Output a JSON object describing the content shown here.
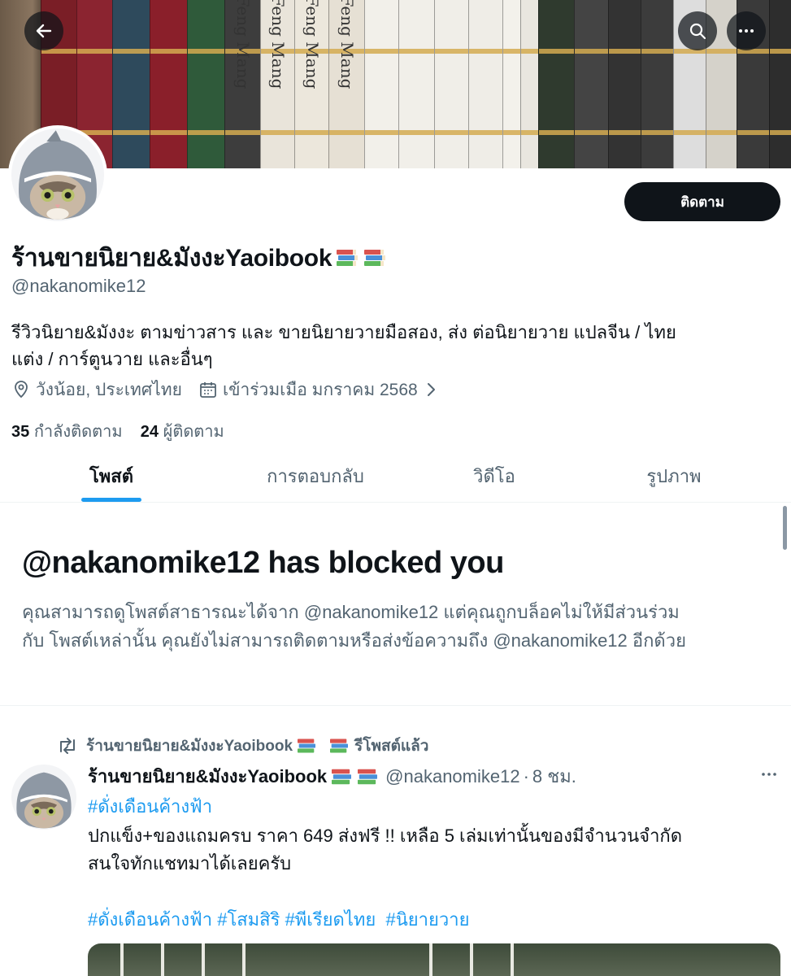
{
  "banner": {
    "books": [
      "",
      "",
      "",
      "",
      "",
      "Feng Mang",
      "Feng Mang",
      "Feng Mang",
      "Feng Mang",
      "",
      "",
      "",
      "",
      "",
      "",
      "",
      ""
    ]
  },
  "profile": {
    "follow_label": "ติดตาม",
    "display_name": "ร้านขายนิยาย&มังงะYaoibook",
    "handle": "@nakanomike12",
    "bio_line1": "รีวิวนิยาย&มังงะ ตามข่าวสาร และ ขายนิยายวายมือสอง, ส่ง ต่อนิยายวาย แปลจีน / ไทย",
    "bio_line2": "แต่ง / การ์ตูนวาย และอื่นๆ",
    "location": "วังน้อย, ประเทศไทย",
    "joined": "เข้าร่วมเมือ มกราคม 2568",
    "following_count": "35",
    "following_label": "กำลังติดตาม",
    "followers_count": "24",
    "followers_label": "ผู้ติดตาม"
  },
  "tabs": [
    {
      "label": "โพสต์",
      "active": true
    },
    {
      "label": "การตอบกลับ",
      "active": false
    },
    {
      "label": "วิดีโอ",
      "active": false
    },
    {
      "label": "รูปภาพ",
      "active": false
    }
  ],
  "blocked": {
    "title": "@nakanomike12 has blocked you",
    "desc_line1": "คุณสามารถดูโพสต์สาธารณะได้จาก @nakanomike12 แต่คุณถูกบล็อคไม่ให้มีส่วนร่วม",
    "desc_line2": "กับ โพสต์เหล่านั้น คุณยังไม่สามารถติดตามหรือส่งข้อความถึง @nakanomike12 อีกด้วย"
  },
  "tweet": {
    "repost_name": "ร้านขายนิยาย&มังงะYaoibook",
    "repost_label": "รีโพสต์แล้ว",
    "author_name": "ร้านขายนิยาย&มังงะYaoibook",
    "author_handle": "@nakanomike12",
    "time": "8 ชม.",
    "hashtag_top": "#ดั่งเดือนค้างฟ้า",
    "line1": "ปกแข็ง+ของแถมครบ ราคา 649 ส่งฟรี !! เหลือ 5 เล่มเท่านั้นของมีจำนวนจำกัด",
    "line2": "สนใจทักแชทมาได้เลยครับ",
    "hashtags": [
      "#ดั่งเดือนค้างฟ้า",
      "#โสมสิริ",
      "#พีเรียดไทย",
      "#นิยายวาย"
    ]
  },
  "icons": {
    "back": "arrow-left-icon",
    "search": "search-icon",
    "more": "more-horizontal-icon",
    "location": "location-pin-icon",
    "calendar": "calendar-icon",
    "chevron": "chevron-right-icon",
    "repost": "repost-icon",
    "book_emoji": "books-emoji-icon"
  },
  "colors": {
    "accent": "#1d9bf0",
    "primary_text": "#0f1419",
    "secondary_text": "#536471",
    "follow_button_bg": "#0f1419",
    "divider": "#eff3f4"
  }
}
